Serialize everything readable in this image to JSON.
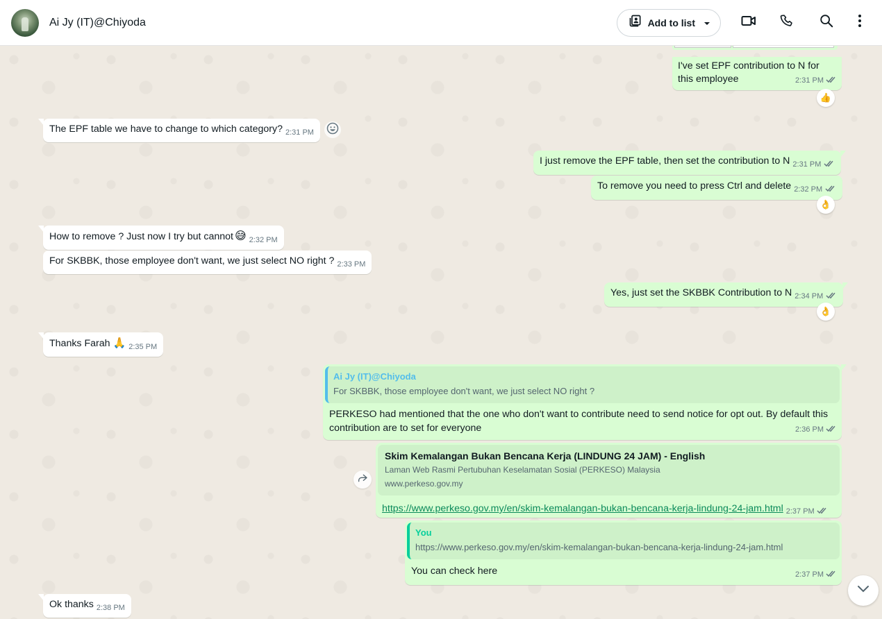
{
  "header": {
    "contact_name": "Ai Jy (IT)@Chiyoda",
    "add_to_list_label": "Add to list"
  },
  "messages": [
    {
      "dir": "out",
      "text": "I've set EPF contribution to N for this employee",
      "time": "2:31 PM",
      "reaction": "👍"
    },
    {
      "dir": "in",
      "text": "The EPF table we have to change to which category?",
      "time": "2:31 PM"
    },
    {
      "dir": "out",
      "text": "I just remove the EPF table, then set the contribution to N",
      "time": "2:31 PM"
    },
    {
      "dir": "out",
      "text": "To remove you need to press Ctrl and delete",
      "time": "2:32 PM",
      "reaction": "👌"
    },
    {
      "dir": "in",
      "text": "How to remove ? Just now I try but cannot",
      "emoji": "😅",
      "time": "2:32 PM"
    },
    {
      "dir": "in",
      "text": "For SKBBK, those employee don't want, we just select NO right ?",
      "time": "2:33 PM"
    },
    {
      "dir": "out",
      "text": "Yes, just set the SKBBK Contribution to N",
      "time": "2:34 PM",
      "reaction": "👌"
    },
    {
      "dir": "in",
      "text": "Thanks Farah",
      "emoji": "🙏",
      "time": "2:35 PM"
    },
    {
      "dir": "out",
      "quote": {
        "name": "Ai Jy (IT)@Chiyoda",
        "text": "For SKBBK, those employee don't want, we just select NO right ?"
      },
      "text": "PERKESO had mentioned that the one who don't want to contribute need to send notice for opt out. By default this contribution are to set for everyone",
      "time": "2:36 PM"
    },
    {
      "dir": "out",
      "preview": {
        "title": "Skim Kemalangan Bukan Bencana Kerja (LINDUNG 24 JAM) - English",
        "description": "Laman Web Rasmi Pertubuhan Keselamatan Sosial (PERKESO) Malaysia",
        "site": "www.perkeso.gov.my"
      },
      "link": "https://www.perkeso.gov.my/en/skim-kemalangan-bukan-bencana-kerja-lindung-24-jam.html",
      "time": "2:37 PM"
    },
    {
      "dir": "out",
      "quote": {
        "name": "You",
        "text": "https://www.perkeso.gov.my/en/skim-kemalangan-bukan-bencana-kerja-lindung-24-jam.html"
      },
      "text": "You can check here",
      "time": "2:37 PM"
    },
    {
      "dir": "in",
      "text": "Ok thanks",
      "time": "2:38 PM"
    }
  ],
  "icons": {
    "avatar": "contact-avatar",
    "add_to_list": "contact-card-icon",
    "video": "video-camera-icon",
    "call": "phone-icon",
    "search": "search-icon",
    "menu": "more-vertical-icon",
    "emoji": "emoji-smile-icon",
    "forward": "forward-arrow-icon",
    "scroll": "chevron-down-icon",
    "read_receipt": "double-check-icon"
  },
  "colors": {
    "outgoing_bubble": "#d9fdd3",
    "incoming_bubble": "#ffffff",
    "chat_background": "#efeae2",
    "quote_contact": "#53bdeb",
    "quote_you": "#06cf9c",
    "link": "#027eb5"
  }
}
